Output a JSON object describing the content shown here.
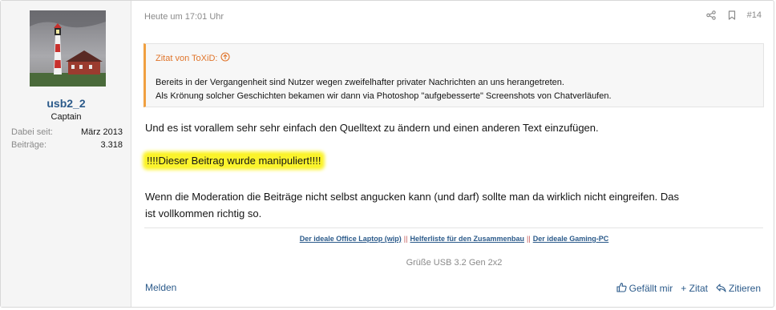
{
  "user": {
    "name": "usb2_2",
    "title": "Captain",
    "stats": [
      {
        "label": "Dabei seit:",
        "value": "März 2013"
      },
      {
        "label": "Beiträge:",
        "value": "3.318"
      }
    ]
  },
  "post": {
    "date": "Heute um 17:01 Uhr",
    "number": "#14",
    "icons": {
      "share": "share-icon",
      "bookmark": "bookmark-icon"
    },
    "quote": {
      "header": "Zitat von ToXiD:",
      "line1": "Bereits in der Vergangenheit sind Nutzer wegen zweifelhafter privater Nachrichten an uns herangetreten.",
      "line2": "Als Krönung solcher Geschichten bekamen wir dann via Photoshop \"aufgebesserte\" Screenshots von Chatverläufen."
    },
    "paragraph1": "Und es ist vorallem sehr sehr einfach den Quelltext zu ändern und einen anderen Text einzufügen.",
    "highlighted": "!!!!Dieser Beitrag wurde manipuliert!!!!",
    "paragraph3a": "Wenn die Moderation die Beiträge nicht selbst angucken kann (und darf) sollte man da wirklich nicht eingreifen. Das",
    "paragraph3b": "ist vollkommen richtig so."
  },
  "signature": {
    "links": [
      "Der ideale Office Laptop (wip)",
      "Helferliste für den Zusammenbau",
      "Der ideale Gaming-PC"
    ],
    "separator": "||",
    "greeting": "Grüße USB 3.2 Gen 2x2"
  },
  "footer": {
    "report": "Melden",
    "like": "Gefällt mir",
    "quote": "+ Zitat",
    "reply": "Zitieren"
  },
  "colors": {
    "link": "#2b5a8a",
    "quote_accent": "#e0742a",
    "highlight": "#fbf32c"
  }
}
